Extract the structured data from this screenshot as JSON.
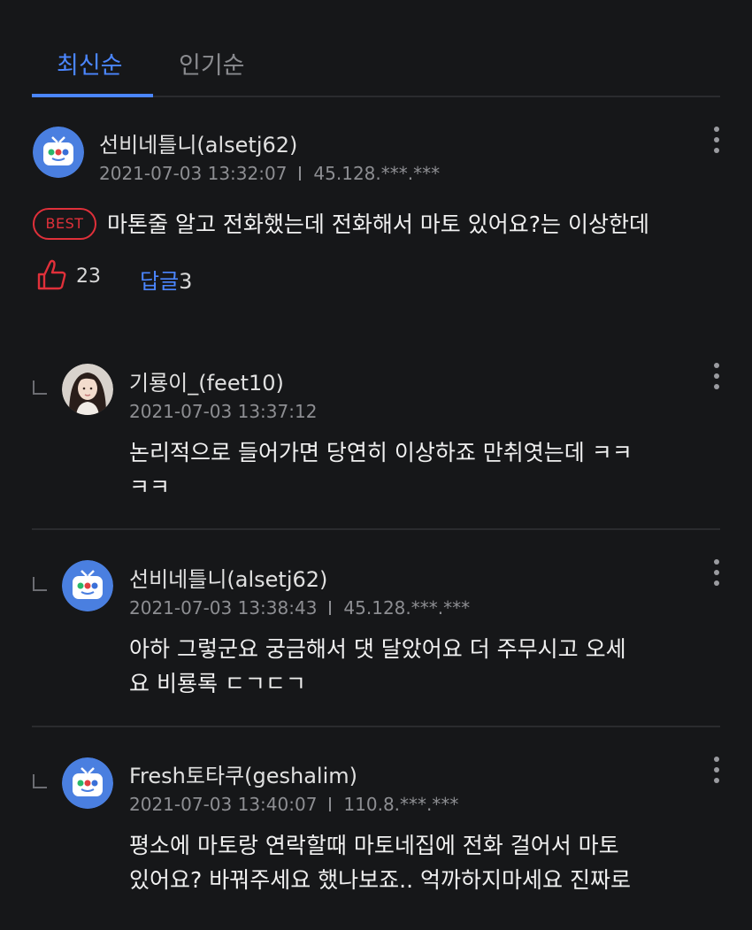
{
  "tabs": [
    {
      "label": "최신순",
      "active": true
    },
    {
      "label": "인기순",
      "active": false
    }
  ],
  "best_badge": "BEST",
  "top_comment": {
    "author": "선비네틀니(alsetj62)",
    "datetime": "2021-07-03 13:32:07",
    "ip": "45.128.***.***",
    "text": "마톤줄 알고 전화했는데 전화해서 마토 있어요?는 이상한데",
    "likes": "23",
    "reply_label": "답글",
    "reply_count": "3"
  },
  "replies": [
    {
      "author": "기룡이_(feet10)",
      "datetime": "2021-07-03 13:37:12",
      "ip": "",
      "line1": "논리적으로 들어가면 당연히 이상하죠 만취엿는데 ㅋㅋ",
      "line2": "ㅋㅋ"
    },
    {
      "author": "선비네틀니(alsetj62)",
      "datetime": "2021-07-03 13:38:43",
      "ip": "45.128.***.***",
      "line1": "아하 그렇군요 궁금해서 댓 달았어요 더 주무시고 오세",
      "line2": "요 비룡록 ㄷㄱㄷㄱ"
    },
    {
      "author": "Fresh토타쿠(geshalim)",
      "datetime": "2021-07-03 13:40:07",
      "ip": "110.8.***.***",
      "line1": "평소에 마토랑 연락할때 마토네집에 전화 걸어서 마토",
      "line2": "있어요? 바꿔주세요 했나보죠.. 억까하지마세요 진짜로"
    }
  ],
  "icons": {
    "avatar_default": "tv-mascot-icon",
    "avatar_photo": "user-photo-avatar",
    "more": "more-vertical-icon",
    "like": "thumbs-up-icon",
    "reply_indicator": "reply-corner-icon"
  },
  "colors": {
    "accent": "#4b86ff",
    "best": "#e0303a",
    "background": "#161719"
  }
}
